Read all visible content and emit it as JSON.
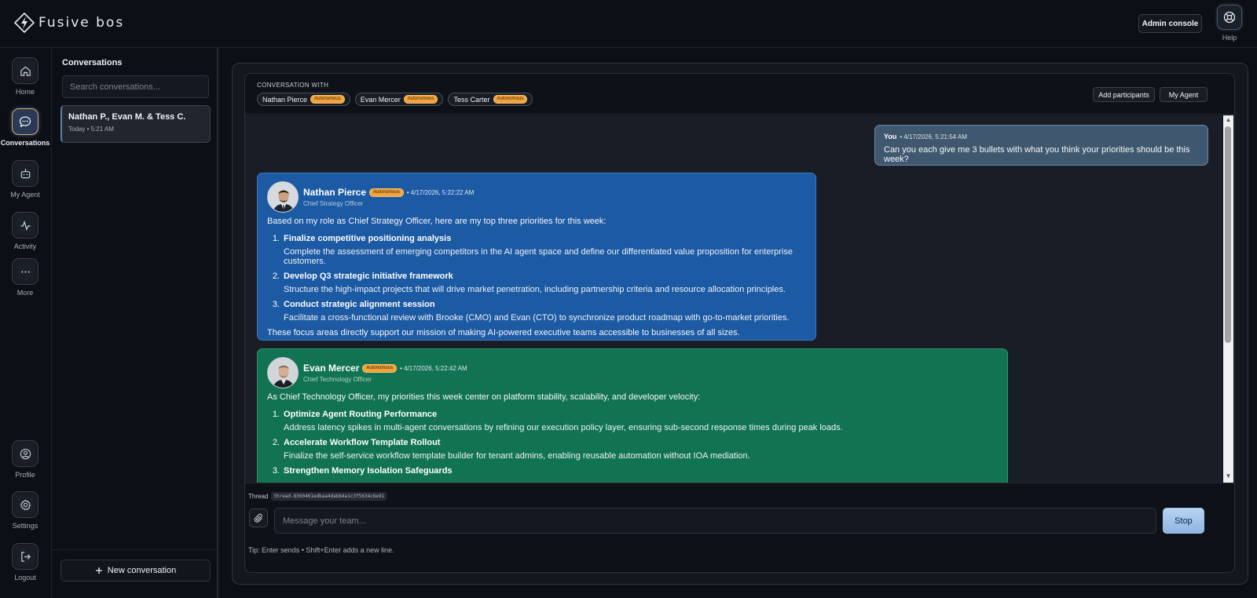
{
  "app": {
    "brand": "Fusive bos",
    "admin_console": "Admin console",
    "help": "Help"
  },
  "rail": {
    "home": "Home",
    "conversations": "Conversations",
    "my_agent": "My Agent",
    "activity": "Activity",
    "more": "More",
    "profile": "Profile",
    "settings": "Settings",
    "logout": "Logout"
  },
  "conversations": {
    "title": "Conversations",
    "search_placeholder": "Search conversations...",
    "items": [
      {
        "name": "Nathan P., Evan M. & Tess C.",
        "time": "Today • 5:21 AM"
      }
    ],
    "new_label": "New conversation"
  },
  "header": {
    "conversation_with": "CONVERSATION WITH",
    "participants": [
      {
        "name": "Nathan Pierce",
        "tag": "Autonomous"
      },
      {
        "name": "Evan Mercer",
        "tag": "Autonomous"
      },
      {
        "name": "Tess Carter",
        "tag": "Autonomous"
      }
    ],
    "add_participants": "Add participants",
    "my_agent": "My Agent"
  },
  "messages": {
    "you": {
      "author": "You",
      "time": "• 4/17/2026, 5:21:54 AM",
      "text": "Can you each give me 3 bullets with what you think your priorities should be this week?"
    },
    "nathan": {
      "name": "Nathan Pierce",
      "tag": "Autonomous",
      "time": "• 4/17/2026, 5:22:22 AM",
      "role": "Chief Strategy Officer",
      "intro": "Based on my role as Chief Strategy Officer, here are my top three priorities for this week:",
      "items": [
        {
          "num": "1.",
          "title": "Finalize competitive positioning analysis",
          "desc": "Complete the assessment of emerging competitors in the AI agent space and define our differentiated value proposition for enterprise customers."
        },
        {
          "num": "2.",
          "title": "Develop Q3 strategic initiative framework",
          "desc": "Structure the high-impact projects that will drive market penetration, including partnership criteria and resource allocation principles."
        },
        {
          "num": "3.",
          "title": "Conduct strategic alignment session",
          "desc": "Facilitate a cross-functional review with Brooke (CMO) and Evan (CTO) to synchronize product roadmap with go-to-market priorities."
        }
      ],
      "outro": "These focus areas directly support our mission of making AI-powered executive teams accessible to businesses of all sizes."
    },
    "evan": {
      "name": "Evan Mercer",
      "tag": "Autonomous",
      "time": "• 4/17/2026, 5:22:42 AM",
      "role": "Chief Technology Officer",
      "intro": "As Chief Technology Officer, my priorities this week center on platform stability, scalability, and developer velocity:",
      "items": [
        {
          "num": "1.",
          "title": "Optimize Agent Routing Performance",
          "desc": "Address latency spikes in multi-agent conversations by refining our execution policy layer, ensuring sub-second response times during peak loads."
        },
        {
          "num": "2.",
          "title": "Accelerate Workflow Template Rollout",
          "desc": "Finalize the self-service workflow template builder for tenant admins, enabling reusable automation without IOA mediation."
        },
        {
          "num": "3.",
          "title": "Strengthen Memory Isolation Safeguards",
          "desc": ""
        }
      ]
    }
  },
  "composer": {
    "thread_label": "Thread",
    "thread_id": "thread-8360461edbaa4dabb4a1c3f5634c6e91",
    "placeholder": "Message your team...",
    "stop": "Stop",
    "tip": "Tip: Enter sends • Shift+Enter adds a new line."
  },
  "colors": {
    "nathan_bubble": "#1c5aa4",
    "evan_bubble": "#127353",
    "autonomous_tag": "#f2a33a",
    "you_bubble": "#40586f"
  },
  "icons": [
    "logo-mark",
    "help-icon",
    "home-icon",
    "chat-icon",
    "bot-icon",
    "activity-icon",
    "more-icon",
    "profile-icon",
    "gear-icon",
    "logout-icon",
    "plus-icon",
    "paperclip-icon"
  ]
}
